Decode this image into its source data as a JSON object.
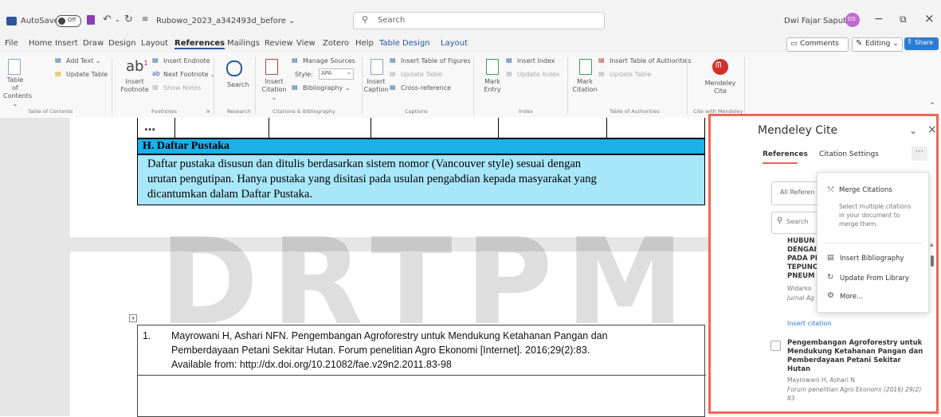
{
  "titlebar": {
    "autosave_label": "AutoSave",
    "toggle_state": "Off",
    "document_title": "Rubowo_2023_a342493d_before ⌄",
    "search_placeholder": "Search",
    "user_name": "Dwi Fajar Saputra",
    "avatar_initials": "DS",
    "minimize_glyph": "−",
    "restore_glyph": "⧉",
    "close_glyph": "×"
  },
  "menu": {
    "items": [
      "File",
      "Home",
      "Insert",
      "Draw",
      "Design",
      "Layout",
      "References",
      "Mailings",
      "Review",
      "View",
      "Zotero",
      "Help",
      "Table Design",
      "Layout"
    ],
    "active": "References",
    "comments_label": "Comments",
    "editing_label": "Editing ⌄",
    "share_label": "Share ⌄"
  },
  "ribbon": {
    "toc": {
      "big": "Table of Contents ⌄",
      "add_text": "Add Text ⌄",
      "update_table": "Update Table",
      "group": "Table of Contents"
    },
    "footnotes": {
      "big": "Insert Footnote",
      "endnote": "Insert Endnote",
      "next": "Next Footnote ⌄",
      "show": "Show Notes",
      "group": "Footnotes",
      "launcher": "⇲"
    },
    "research": {
      "big": "Search",
      "group": "Research"
    },
    "citations": {
      "big": "Insert Citation ⌄",
      "manage": "Manage Sources",
      "style_label": "Style:",
      "style_value": "APA",
      "bibliography": "Bibliography ⌄",
      "group": "Citations & Bibliography"
    },
    "captions": {
      "big": "Insert Caption",
      "tof": "Insert Table of Figures",
      "update": "Update Table",
      "cross": "Cross-reference",
      "group": "Captions"
    },
    "index": {
      "big": "Mark Entry",
      "insert": "Insert Index",
      "update": "Update Index",
      "group": "Index"
    },
    "toa": {
      "big": "Mark Citation",
      "insert": "Insert Table of Authorities",
      "update": "Update Table",
      "group": "Table of Authorities"
    },
    "mendeley": {
      "big": "Mendeley Cite",
      "group": "Cite with Mendeley"
    },
    "collapse_glyph": "⌄"
  },
  "document": {
    "ellipsis": "…",
    "section_heading": "H. Daftar Pustaka",
    "section_lines": [
      "Daftar pustaka disusun dan ditulis berdasarkan sistem nomor (Vancouver style) sesuai dengan",
      "urutan pengutipan. Hanya pustaka yang disitasi pada usulan pengabdian kepada masyarakat yang",
      "dicantumkan dalam Daftar Pustaka."
    ],
    "bib_number": "1.",
    "bib_lines": [
      "Mayrowani H, Ashari NFN. Pengembangan Agroforestry untuk Mendukung Ketahanan Pangan dan",
      "Pemberdayaan Petani Sekitar Hutan. Forum penelitian Agro Ekonomi [Internet]. 2016;29(2):83.",
      "Available from: http://dx.doi.org/10.21082/fae.v29n2.2011.83-98"
    ],
    "colors": {
      "heading_bg": "#1cb0e8",
      "section_bg": "#a8e6f9"
    }
  },
  "watermark": "DRTPM",
  "mendeley": {
    "title": "Mendeley Cite",
    "chevron": "⌄",
    "close": "×",
    "tabs": [
      "References",
      "Citation Settings"
    ],
    "more_glyph": "⋯",
    "filter_label": "All Referen",
    "search_label": "Search",
    "ref1_title_lines": [
      "HUBUN",
      "DENGAI",
      "PADA PI",
      "TEPUNC",
      "PNEUM"
    ],
    "ref1_author": "Widarko ",
    "ref1_journal": "Jurnal Ag",
    "insert_citation": "Insert citation",
    "ref2_title_lines": [
      "Pengembangan Agroforestry untuk",
      "Mendukung Ketahanan Pangan dan",
      "Pemberdayaan Petani Sekitar",
      "Hutan"
    ],
    "ref2_author": "Mayrowani H, Ashari N",
    "ref2_journal": "Forum penelitian Agro Ekonomi (2016) 29(2)",
    "ref2_pages": "83",
    "menu": {
      "merge_title": "Merge Citations",
      "merge_desc": [
        "Select multiple citations",
        "in your document to",
        "merge them."
      ],
      "insert_bib": "Insert Bibliography",
      "update_lib": "Update From Library",
      "more": "More..."
    },
    "accent": "#ee6655"
  }
}
